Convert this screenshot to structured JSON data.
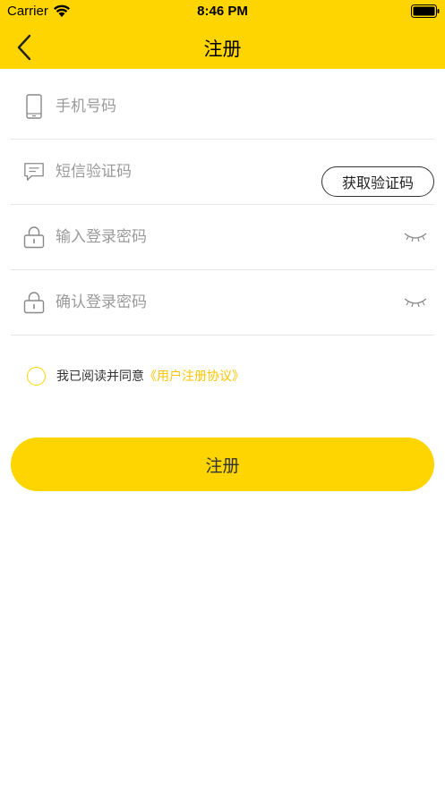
{
  "status_bar": {
    "carrier": "Carrier",
    "time": "8:46 PM"
  },
  "nav": {
    "title": "注册",
    "back_icon": "chevron-left-icon"
  },
  "form": {
    "phone": {
      "placeholder": "手机号码",
      "icon": "phone-icon"
    },
    "sms_code": {
      "placeholder": "短信验证码",
      "icon": "message-icon",
      "get_code_label": "获取验证码"
    },
    "password": {
      "placeholder": "输入登录密码",
      "icon": "lock-icon",
      "toggle_icon": "eye-closed-icon"
    },
    "confirm_password": {
      "placeholder": "确认登录密码",
      "icon": "lock-icon",
      "toggle_icon": "eye-closed-icon"
    }
  },
  "agreement": {
    "text": "我已阅读并同意",
    "link": "《用户注册协议》"
  },
  "submit": {
    "label": "注册"
  },
  "colors": {
    "accent": "#FFD500",
    "link": "#FFC400"
  }
}
